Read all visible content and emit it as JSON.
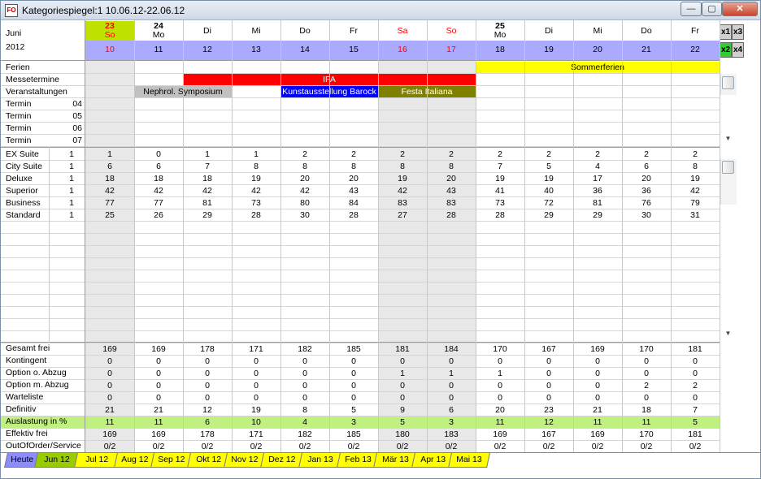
{
  "window": {
    "title": "Kategoriespiegel:1 10.06.12-22.06.12",
    "icon_text": "FO",
    "minimize": "—",
    "maximize": "▢",
    "close": "✕"
  },
  "header": {
    "month": "Juni",
    "year": "2012"
  },
  "days": [
    {
      "top": "23",
      "dow": "So",
      "num": "10"
    },
    {
      "top": "24",
      "dow": "Mo",
      "num": "11"
    },
    {
      "top": "",
      "dow": "Di",
      "num": "12"
    },
    {
      "top": "",
      "dow": "Mi",
      "num": "13"
    },
    {
      "top": "",
      "dow": "Do",
      "num": "14"
    },
    {
      "top": "",
      "dow": "Fr",
      "num": "15"
    },
    {
      "top": "",
      "dow": "Sa",
      "num": "16"
    },
    {
      "top": "",
      "dow": "So",
      "num": "17"
    },
    {
      "top": "25",
      "dow": "Mo",
      "num": "18"
    },
    {
      "top": "",
      "dow": "Di",
      "num": "19"
    },
    {
      "top": "",
      "dow": "Mi",
      "num": "20"
    },
    {
      "top": "",
      "dow": "Do",
      "num": "21"
    },
    {
      "top": "",
      "dow": "Fr",
      "num": "22"
    }
  ],
  "zoom_buttons": [
    "x1",
    "x3",
    "x2",
    "x4"
  ],
  "event_rows": [
    {
      "label": "Ferien",
      "num": ""
    },
    {
      "label": "Messetermine",
      "num": ""
    },
    {
      "label": "Veranstaltungen",
      "num": ""
    },
    {
      "label": "Termin",
      "num": "04"
    },
    {
      "label": "Termin",
      "num": "05"
    },
    {
      "label": "Termin",
      "num": "06"
    },
    {
      "label": "Termin",
      "num": "07"
    }
  ],
  "events": [
    {
      "name": "Sommerferien",
      "row": 0,
      "start": 8,
      "span": 5,
      "bg": "#ffff00",
      "fg": "#000000"
    },
    {
      "name": "IFA",
      "row": 1,
      "start": 2,
      "span": 6,
      "bg": "#ff0000",
      "fg": "#ffffff"
    },
    {
      "name": "Nephrol. Symposium",
      "row": 2,
      "start": 1,
      "span": 2,
      "bg": "#c0c0c0",
      "fg": "#000000"
    },
    {
      "name": "Kunstausstellung Barock",
      "row": 2,
      "start": 4,
      "span": 2,
      "bg": "#0000ff",
      "fg": "#ffffff"
    },
    {
      "name": "Festa Italiana",
      "row": 2,
      "start": 6,
      "span": 2,
      "bg": "#808000",
      "fg": "#ffffff"
    }
  ],
  "categories": [
    {
      "name": "EX Suite",
      "n": "1",
      "values": [
        "1",
        "0",
        "1",
        "1",
        "2",
        "2",
        "2",
        "2",
        "2",
        "2",
        "2",
        "2",
        "2"
      ]
    },
    {
      "name": "City Suite",
      "n": "1",
      "values": [
        "6",
        "6",
        "7",
        "8",
        "8",
        "8",
        "8",
        "8",
        "7",
        "5",
        "4",
        "6",
        "8"
      ]
    },
    {
      "name": "Deluxe",
      "n": "1",
      "values": [
        "18",
        "18",
        "18",
        "19",
        "20",
        "20",
        "19",
        "20",
        "19",
        "19",
        "17",
        "20",
        "19"
      ]
    },
    {
      "name": "Superior",
      "n": "1",
      "values": [
        "42",
        "42",
        "42",
        "42",
        "42",
        "43",
        "42",
        "43",
        "41",
        "40",
        "36",
        "36",
        "42"
      ]
    },
    {
      "name": "Business",
      "n": "1",
      "values": [
        "77",
        "77",
        "81",
        "73",
        "80",
        "84",
        "83",
        "83",
        "73",
        "72",
        "81",
        "76",
        "79"
      ]
    },
    {
      "name": "Standard",
      "n": "1",
      "values": [
        "25",
        "26",
        "29",
        "28",
        "30",
        "28",
        "27",
        "28",
        "28",
        "29",
        "29",
        "30",
        "31"
      ]
    }
  ],
  "summary": [
    {
      "name": "Gesamt frei",
      "values": [
        "169",
        "169",
        "178",
        "171",
        "182",
        "185",
        "181",
        "184",
        "170",
        "167",
        "169",
        "170",
        "181"
      ]
    },
    {
      "name": "Kontingent",
      "values": [
        "0",
        "0",
        "0",
        "0",
        "0",
        "0",
        "0",
        "0",
        "0",
        "0",
        "0",
        "0",
        "0"
      ]
    },
    {
      "name": "Option o. Abzug",
      "values": [
        "0",
        "0",
        "0",
        "0",
        "0",
        "0",
        "1",
        "1",
        "1",
        "0",
        "0",
        "0",
        "0"
      ]
    },
    {
      "name": "Option m. Abzug",
      "values": [
        "0",
        "0",
        "0",
        "0",
        "0",
        "0",
        "0",
        "0",
        "0",
        "0",
        "0",
        "2",
        "2"
      ]
    },
    {
      "name": "Warteliste",
      "values": [
        "0",
        "0",
        "0",
        "0",
        "0",
        "0",
        "0",
        "0",
        "0",
        "0",
        "0",
        "0",
        "0"
      ]
    },
    {
      "name": "Definitiv",
      "values": [
        "21",
        "21",
        "12",
        "19",
        "8",
        "5",
        "9",
        "6",
        "20",
        "23",
        "21",
        "18",
        "7"
      ]
    },
    {
      "name": "Auslastung in %",
      "values": [
        "11",
        "11",
        "6",
        "10",
        "4",
        "3",
        "5",
        "3",
        "11",
        "12",
        "11",
        "11",
        "5"
      ]
    },
    {
      "name": "Effektiv frei",
      "values": [
        "169",
        "169",
        "178",
        "171",
        "182",
        "185",
        "180",
        "183",
        "169",
        "167",
        "169",
        "170",
        "181"
      ]
    },
    {
      "name": "OutOfOrder/Service",
      "values": [
        "0/2",
        "0/2",
        "0/2",
        "0/2",
        "0/2",
        "0/2",
        "0/2",
        "0/2",
        "0/2",
        "0/2",
        "0/2",
        "0/2",
        "0/2"
      ]
    }
  ],
  "tabs": [
    {
      "label": "Heute",
      "bg": "#8c8cff"
    },
    {
      "label": "Jun 12",
      "bg": "#99cc00"
    },
    {
      "label": "Jul 12",
      "bg": "#ffff00"
    },
    {
      "label": "Aug 12",
      "bg": "#ffff00"
    },
    {
      "label": "Sep 12",
      "bg": "#ffff00"
    },
    {
      "label": "Okt 12",
      "bg": "#ffff00"
    },
    {
      "label": "Nov 12",
      "bg": "#ffff00"
    },
    {
      "label": "Dez 12",
      "bg": "#ffff00"
    },
    {
      "label": "Jan 13",
      "bg": "#ffff00"
    },
    {
      "label": "Feb 13",
      "bg": "#ffff00"
    },
    {
      "label": "Mär 13",
      "bg": "#ffff00"
    },
    {
      "label": "Apr 13",
      "bg": "#ffff00"
    },
    {
      "label": "Mai 13",
      "bg": "#ffff00"
    }
  ],
  "colors": {
    "today_highlight": "#c0e000",
    "header_blue": "#aaaaff",
    "weekend_red": "#ff0000",
    "weekend_shade": "#e8e8e8",
    "utilization_row": "#c0f080"
  }
}
